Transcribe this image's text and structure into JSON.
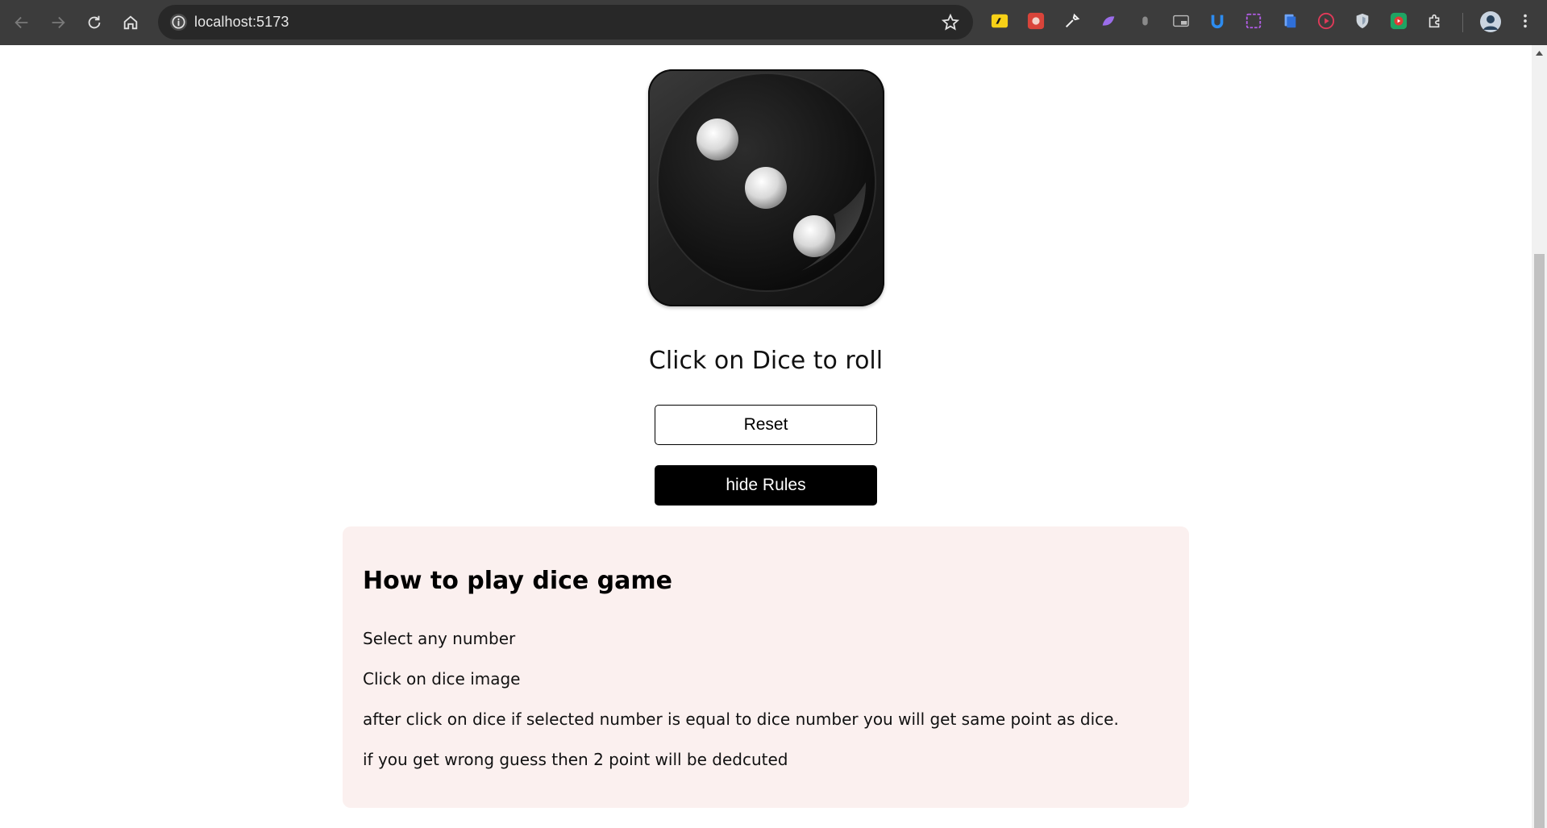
{
  "browser": {
    "url": "localhost:5173",
    "icons": [
      "back-icon",
      "forward-icon",
      "reload-icon",
      "home-icon",
      "site-info-icon",
      "bookmark-star-icon",
      "extensions-puzzle-icon",
      "profile-avatar-icon",
      "more-menu-icon"
    ]
  },
  "dice": {
    "current_value": 3
  },
  "game": {
    "instruction": "Click on Dice to roll",
    "reset_label": "Reset",
    "toggle_rules_label": "hide Rules"
  },
  "rules": {
    "title": "How to play dice game",
    "items": [
      "Select any number",
      "Click on dice image",
      "after click on dice if selected number is equal to dice number you will get same point as dice.",
      "if you get wrong guess then 2 point will be dedcuted"
    ]
  },
  "colors": {
    "chrome_bg": "#3c3c3c",
    "omnibox_bg": "#282828",
    "rules_bg": "#fbf0ef",
    "primary_button": "#000000"
  }
}
